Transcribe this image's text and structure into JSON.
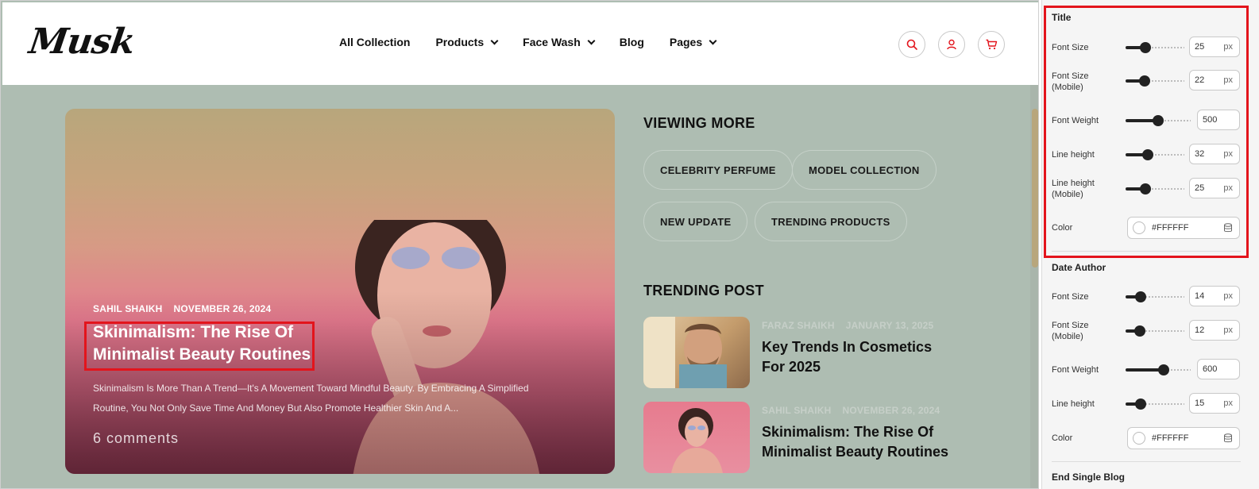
{
  "header": {
    "logo": "Musk",
    "nav": [
      {
        "label": "All Collection",
        "dropdown": false
      },
      {
        "label": "Products",
        "dropdown": true
      },
      {
        "label": "Face Wash",
        "dropdown": true
      },
      {
        "label": "Blog",
        "dropdown": false
      },
      {
        "label": "Pages",
        "dropdown": true
      }
    ],
    "icons": [
      "search-icon",
      "user-icon",
      "cart-icon"
    ],
    "icon_color": "#e3141c"
  },
  "hero": {
    "author": "SAHIL SHAIKH",
    "date": "NOVEMBER 26, 2024",
    "title": "Skinimalism: The Rise Of Minimalist Beauty Routines",
    "excerpt": "Skinimalism Is More Than A Trend—It's A Movement Toward Mindful Beauty. By Embracing A Simplified Routine, You Not Only Save Time And Money But Also Promote Healthier Skin And A...",
    "comments": "6 comments"
  },
  "viewing_more": {
    "heading": "VIEWING MORE",
    "tags": [
      "CELEBRITY PERFUME",
      "MODEL COLLECTION",
      "NEW UPDATE",
      "TRENDING PRODUCTS"
    ]
  },
  "trending": {
    "heading": "TRENDING POST",
    "posts": [
      {
        "author": "FARAZ SHAIKH",
        "date": "JANUARY 13, 2025",
        "title": "Key Trends In Cosmetics For 2025"
      },
      {
        "author": "SAHIL SHAIKH",
        "date": "NOVEMBER 26, 2024",
        "title": "Skinimalism: The Rise Of Minimalist Beauty Routines"
      }
    ]
  },
  "panel": {
    "title_group": {
      "label": "Title",
      "font_size": {
        "label": "Font Size",
        "value": "25",
        "unit": "px",
        "level": 0.3
      },
      "font_size_mobile": {
        "label": "Font Size (Mobile)",
        "value": "22",
        "unit": "px",
        "level": 0.28
      },
      "font_weight": {
        "label": "Font Weight",
        "value": "500",
        "level": 0.5
      },
      "line_height": {
        "label": "Line height",
        "value": "32",
        "unit": "px",
        "level": 0.35
      },
      "line_height_mobile": {
        "label": "Line height (Mobile)",
        "value": "25",
        "unit": "px",
        "level": 0.3
      },
      "color": {
        "label": "Color",
        "value": "#FFFFFF"
      }
    },
    "date_author_group": {
      "label": "Date Author",
      "font_size": {
        "label": "Font Size",
        "value": "14",
        "unit": "px",
        "level": 0.2
      },
      "font_size_mobile": {
        "label": "Font Size (Mobile)",
        "value": "12",
        "unit": "px",
        "level": 0.18
      },
      "font_weight": {
        "label": "Font Weight",
        "value": "600",
        "level": 0.6
      },
      "line_height": {
        "label": "Line height",
        "value": "15",
        "unit": "px",
        "level": 0.2
      },
      "color": {
        "label": "Color",
        "value": "#FFFFFF"
      }
    },
    "end_label": "End Single Blog"
  },
  "colors": {
    "highlight": "#e3141c",
    "preview_bg": "#aebdb2"
  }
}
